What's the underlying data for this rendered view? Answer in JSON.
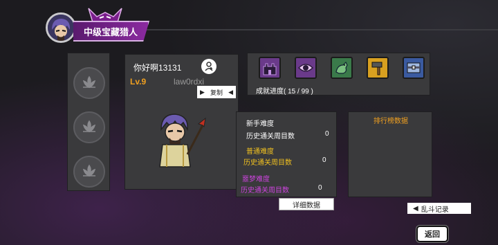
{
  "header": {
    "title": "中级宝藏猎人"
  },
  "character": {
    "name": "你好啊13131",
    "level": "Lv.9",
    "player_id": "law0rdxi",
    "copy_label": "复制"
  },
  "achievements": {
    "icons": [
      "dungeon-icon",
      "eye-icon",
      "dinosaur-icon",
      "hammer-icon",
      "vault-icon"
    ],
    "progress_text": "成就进度( 15 / 99 )"
  },
  "difficulty": {
    "novice": {
      "title": "新手难度",
      "label": "历史通关周目数",
      "value": "0",
      "color": "#ffffff"
    },
    "normal": {
      "title": "普通难度",
      "label": "历史通关周目数",
      "value": "0",
      "color": "#f0c020"
    },
    "nightmare": {
      "title": "噩梦难度",
      "label": "历史通关周目数",
      "value": "0",
      "color": "#cc44dd"
    }
  },
  "ranking": {
    "title": "排行榜数据"
  },
  "buttons": {
    "detail": "详细数据",
    "brawl_record": "乱斗记录",
    "back": "返回"
  },
  "colors": {
    "accent_orange": "#f0a020",
    "title_purple": "#8b2aa0"
  }
}
